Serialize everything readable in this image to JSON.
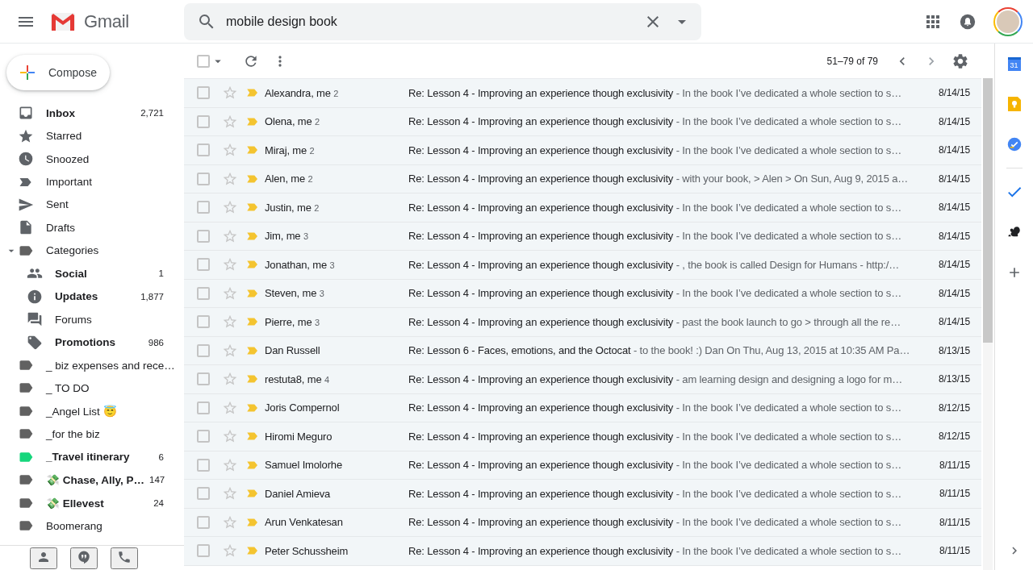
{
  "header": {
    "app_name": "Gmail",
    "search": {
      "value": "mobile design book"
    }
  },
  "compose": {
    "label": "Compose"
  },
  "sidebar": {
    "items": [
      {
        "kind": "inbox",
        "label": "Inbox",
        "count": "2,721",
        "bold": true
      },
      {
        "kind": "star",
        "label": "Starred",
        "bold": false
      },
      {
        "kind": "clock",
        "label": "Snoozed",
        "bold": false
      },
      {
        "kind": "important",
        "label": "Important",
        "bold": false
      },
      {
        "kind": "send",
        "label": "Sent",
        "bold": false
      },
      {
        "kind": "draft",
        "label": "Drafts",
        "bold": false
      },
      {
        "kind": "label",
        "label": "Categories",
        "bold": false,
        "color": "#616161",
        "expanded": true,
        "children": [
          {
            "kind": "people",
            "label": "Social",
            "count": "1",
            "bold": true
          },
          {
            "kind": "info",
            "label": "Updates",
            "count": "1,877",
            "bold": true
          },
          {
            "kind": "forum",
            "label": "Forums",
            "bold": false
          },
          {
            "kind": "tag",
            "label": "Promotions",
            "count": "986",
            "bold": true
          }
        ]
      },
      {
        "kind": "label",
        "label": "_ biz expenses and rece…",
        "bold": false,
        "color": "#616161"
      },
      {
        "kind": "label",
        "label": "_ TO DO",
        "bold": false,
        "color": "#616161"
      },
      {
        "kind": "label",
        "label": "_Angel List 😇",
        "bold": false,
        "color": "#616161"
      },
      {
        "kind": "label",
        "label": "_for the biz",
        "bold": false,
        "color": "#616161"
      },
      {
        "kind": "label",
        "label": "_Travel itinerary",
        "count": "6",
        "bold": true,
        "color": "#16d67c"
      },
      {
        "kind": "label",
        "label": "💸 Chase, Ally, P…",
        "count": "147",
        "bold": true,
        "color": "#616161"
      },
      {
        "kind": "label",
        "label": "💸 Ellevest",
        "count": "24",
        "bold": true,
        "color": "#616161"
      },
      {
        "kind": "label",
        "label": "Boomerang",
        "bold": false,
        "color": "#616161"
      }
    ]
  },
  "toolbar": {
    "select_all": {
      "checked": false
    },
    "page_info": "51–79 of 79"
  },
  "emails": [
    {
      "sender": "Alexandra, me",
      "count": "2",
      "subject": "Re: Lesson 4 - Improving an experience though exclusivity",
      "snippet": "- In the book I’ve dedicated a whole section to s…",
      "date": "8/14/15",
      "checked": false,
      "starred": false,
      "important": true
    },
    {
      "sender": "Olena, me",
      "count": "2",
      "subject": "Re: Lesson 4 - Improving an experience though exclusivity",
      "snippet": "- In the book I’ve dedicated a whole section to s…",
      "date": "8/14/15",
      "checked": false,
      "starred": false,
      "important": true
    },
    {
      "sender": "Miraj, me",
      "count": "2",
      "subject": "Re: Lesson 4 - Improving an experience though exclusivity",
      "snippet": "- In the book I’ve dedicated a whole section to s…",
      "date": "8/14/15",
      "checked": false,
      "starred": false,
      "important": true
    },
    {
      "sender": "Alen, me",
      "count": "2",
      "subject": "Re: Lesson 4 - Improving an experience though exclusivity",
      "snippet": "- with your book, > Alen > On Sun, Aug 9, 2015 a…",
      "date": "8/14/15",
      "checked": false,
      "starred": false,
      "important": true
    },
    {
      "sender": "Justin, me",
      "count": "2",
      "subject": "Re: Lesson 4 - Improving an experience though exclusivity",
      "snippet": "- In the book I’ve dedicated a whole section to s…",
      "date": "8/14/15",
      "checked": false,
      "starred": false,
      "important": true
    },
    {
      "sender": "Jim, me",
      "count": "3",
      "subject": "Re: Lesson 4 - Improving an experience though exclusivity",
      "snippet": "- In the book I’ve dedicated a whole section to s…",
      "date": "8/14/15",
      "checked": false,
      "starred": false,
      "important": true
    },
    {
      "sender": "Jonathan, me",
      "count": "3",
      "subject": "Re: Lesson 4 - Improving an experience though exclusivity",
      "snippet": "- , the book is called Design for Humans - http:/…",
      "date": "8/14/15",
      "checked": false,
      "starred": false,
      "important": true
    },
    {
      "sender": "Steven, me",
      "count": "3",
      "subject": "Re: Lesson 4 - Improving an experience though exclusivity",
      "snippet": "- In the book I’ve dedicated a whole section to s…",
      "date": "8/14/15",
      "checked": false,
      "starred": false,
      "important": true
    },
    {
      "sender": "Pierre, me",
      "count": "3",
      "subject": "Re: Lesson 4 - Improving an experience though exclusivity",
      "snippet": "- past the book launch to go > through all the re…",
      "date": "8/14/15",
      "checked": false,
      "starred": false,
      "important": true
    },
    {
      "sender": "Dan Russell",
      "subject": "Re: Lesson 6 - Faces, emotions, and the Octocat",
      "snippet": "- to the book! :) Dan On Thu, Aug 13, 2015 at 10:35 AM Pa…",
      "date": "8/13/15",
      "checked": false,
      "starred": false,
      "important": true
    },
    {
      "sender": "restuta8, me",
      "count": "4",
      "subject": "Re: Lesson 4 - Improving an experience though exclusivity",
      "snippet": "- am learning design and designing a logo for m…",
      "date": "8/13/15",
      "checked": false,
      "starred": false,
      "important": true
    },
    {
      "sender": "Joris Compernol",
      "subject": "Re: Lesson 4 - Improving an experience though exclusivity",
      "snippet": "- In the book I’ve dedicated a whole section to s…",
      "date": "8/12/15",
      "checked": false,
      "starred": false,
      "important": true
    },
    {
      "sender": "Hiromi Meguro",
      "subject": "Re: Lesson 4 - Improving an experience though exclusivity",
      "snippet": "- In the book I’ve dedicated a whole section to s…",
      "date": "8/12/15",
      "checked": false,
      "starred": false,
      "important": true
    },
    {
      "sender": "Samuel Imolorhe",
      "subject": "Re: Lesson 4 - Improving an experience though exclusivity",
      "snippet": "- In the book I’ve dedicated a whole section to s…",
      "date": "8/11/15",
      "checked": false,
      "starred": false,
      "important": true
    },
    {
      "sender": "Daniel Amieva",
      "subject": "Re: Lesson 4 - Improving an experience though exclusivity",
      "snippet": "- In the book I’ve dedicated a whole section to s…",
      "date": "8/11/15",
      "checked": false,
      "starred": false,
      "important": true
    },
    {
      "sender": "Arun Venkatesan",
      "subject": "Re: Lesson 4 - Improving an experience though exclusivity",
      "snippet": "- In the book I’ve dedicated a whole section to s…",
      "date": "8/11/15",
      "checked": false,
      "starred": false,
      "important": true
    },
    {
      "sender": "Peter Schussheim",
      "subject": "Re: Lesson 4 - Improving an experience though exclusivity",
      "snippet": "- In the book I’ve dedicated a whole section to s…",
      "date": "8/11/15",
      "checked": false,
      "starred": false,
      "important": true
    }
  ],
  "rail": {
    "calendar_day": "31"
  }
}
